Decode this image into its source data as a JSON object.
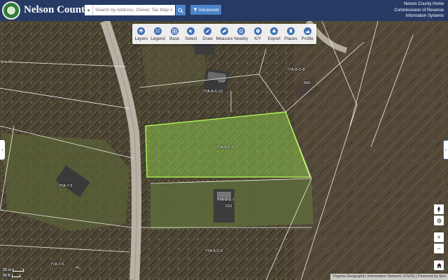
{
  "header": {
    "title": "Nelson County,",
    "search_placeholder": "Search by Address, Owner, Tax Map #",
    "advanced_label": "Advanced",
    "links": [
      "Nelson County Home",
      "Commissioner of Revenue",
      "Information Systems"
    ]
  },
  "toolbar": {
    "tools": [
      {
        "label": "Layers",
        "icon": "layers-icon"
      },
      {
        "label": "Legend",
        "icon": "legend-icon"
      },
      {
        "label": "Base",
        "icon": "basemap-icon"
      },
      {
        "label": "Select",
        "icon": "select-icon"
      },
      {
        "label": "Draw",
        "icon": "draw-icon"
      },
      {
        "label": "Measure",
        "icon": "measure-icon"
      },
      {
        "label": "Nearby",
        "icon": "nearby-icon"
      },
      {
        "label": "X/Y",
        "icon": "xy-icon"
      },
      {
        "label": "Export",
        "icon": "export-icon"
      },
      {
        "label": "Places",
        "icon": "places-icon"
      },
      {
        "label": "Profile",
        "icon": "profile-icon"
      }
    ]
  },
  "map": {
    "parcels": [
      {
        "label": "77A-8-C-9"
      },
      {
        "label": "77A-8-C-10"
      },
      {
        "label": "77A-8-C-8"
      },
      {
        "label": "77A-8-C-7"
      },
      {
        "label": "77A-8-C-6"
      },
      {
        "label": "77A-7-5"
      },
      {
        "label": "77A-7-6"
      },
      {
        "label": "7-1-30"
      }
    ],
    "addresses": [
      "542",
      "560",
      "510",
      "41"
    ],
    "highlight_color": "#8bc34a"
  },
  "controls": {
    "compass": "compass-icon",
    "home": "home-icon",
    "zoom_in": "+",
    "zoom_out": "−",
    "locate": "locate-icon"
  },
  "scale": {
    "metric": "20 m",
    "imperial": "50 ft"
  },
  "attribution": "Virginia Geographic Information Network (VGIN)  |  Powered by Esri"
}
